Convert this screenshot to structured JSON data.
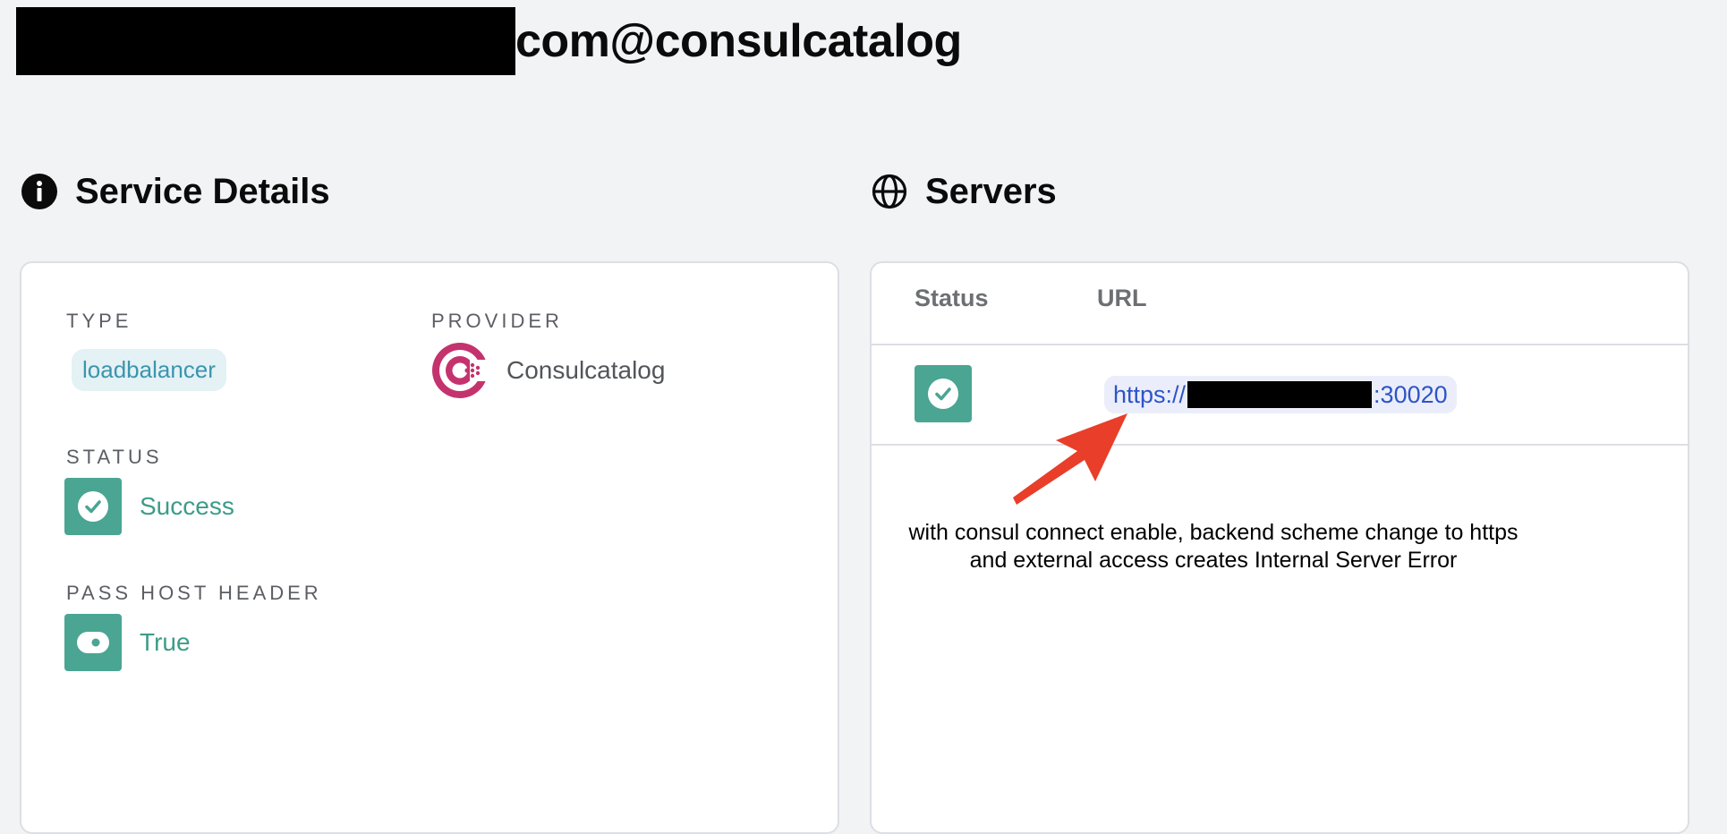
{
  "page": {
    "title_suffix": "com@consulcatalog"
  },
  "service_details": {
    "header": "Service Details",
    "icon": "info-circle-icon",
    "type": {
      "label": "TYPE",
      "value": "loadbalancer"
    },
    "provider": {
      "label": "PROVIDER",
      "value": "Consulcatalog",
      "icon": "consul-logo-icon"
    },
    "status": {
      "label": "STATUS",
      "value": "Success",
      "icon": "check-circle-icon"
    },
    "pass_host_header": {
      "label": "PASS HOST HEADER",
      "value": "True",
      "icon": "toggle-on-icon"
    }
  },
  "servers": {
    "header": "Servers",
    "icon": "globe-icon",
    "columns": [
      "Status",
      "URL"
    ],
    "rows": [
      {
        "status_icon": "check-circle-icon",
        "url_prefix": "https://",
        "url_suffix": ":30020"
      }
    ]
  },
  "annotation": {
    "text": "with consul connect enable, backend scheme change to https\nand external access creates Internal Server Error"
  },
  "colors": {
    "background": "#f2f3f5",
    "success_green": "#4aa593",
    "type_chip_text": "#3b95ad",
    "url_text": "#2d54c8",
    "arrow_red": "#e83e2a",
    "consul_pink": "#c4336e"
  }
}
